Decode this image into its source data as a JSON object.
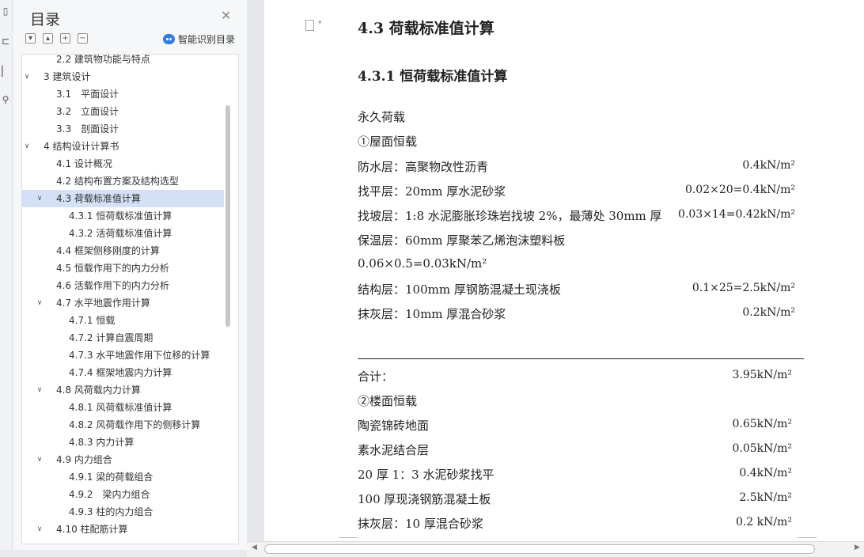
{
  "navigation": {
    "title": "目录",
    "smart_button_label": "智能识别目录",
    "toolbar": {
      "collapse": "−",
      "expand": "+"
    },
    "items": [
      {
        "label": "2.2 建筑物功能与特点",
        "level": 2,
        "expanded": null
      },
      {
        "label": "3 建筑设计",
        "level": 1,
        "expanded": true
      },
      {
        "label": "3.1　平面设计",
        "level": 2,
        "expanded": null
      },
      {
        "label": "3.2　立面设计",
        "level": 2,
        "expanded": null
      },
      {
        "label": "3.3　剖面设计",
        "level": 2,
        "expanded": null
      },
      {
        "label": "4 结构设计计算书",
        "level": 1,
        "expanded": true
      },
      {
        "label": "4.1 设计概况",
        "level": 2,
        "expanded": null
      },
      {
        "label": "4.2 结构布置方案及结构选型",
        "level": 2,
        "expanded": null
      },
      {
        "label": "4.3 荷载标准值计算",
        "level": 2,
        "expanded": true,
        "selected": true
      },
      {
        "label": "4.3.1 恒荷载标准值计算",
        "level": 3,
        "expanded": null
      },
      {
        "label": "4.3.2 活荷载标准值计算",
        "level": 3,
        "expanded": null
      },
      {
        "label": "4.4 框架侧移刚度的计算",
        "level": 2,
        "expanded": null
      },
      {
        "label": "4.5 恒载作用下的内力分析",
        "level": 2,
        "expanded": null
      },
      {
        "label": "4.6 活载作用下的内力分析",
        "level": 2,
        "expanded": null
      },
      {
        "label": "4.7 水平地震作用计算",
        "level": 2,
        "expanded": true
      },
      {
        "label": "4.7.1 恒载",
        "level": 3,
        "expanded": null
      },
      {
        "label": "4.7.2 计算自震周期",
        "level": 3,
        "expanded": null
      },
      {
        "label": "4.7.3 水平地震作用下位移的计算",
        "level": 3,
        "expanded": null
      },
      {
        "label": "4.7.4 框架地震内力计算",
        "level": 3,
        "expanded": null
      },
      {
        "label": "4.8 风荷载内力计算",
        "level": 2,
        "expanded": true
      },
      {
        "label": "4.8.1 风荷载标准值计算",
        "level": 3,
        "expanded": null
      },
      {
        "label": "4.8.2 风荷载作用下的侧移计算",
        "level": 3,
        "expanded": null
      },
      {
        "label": "4.8.3 内力计算",
        "level": 3,
        "expanded": null
      },
      {
        "label": "4.9 内力组合",
        "level": 2,
        "expanded": true
      },
      {
        "label": "4.9.1 梁的荷载组合",
        "level": 3,
        "expanded": null
      },
      {
        "label": "4.9.2　梁内力组合",
        "level": 3,
        "expanded": null
      },
      {
        "label": "4.9.3 柱的内力组合",
        "level": 3,
        "expanded": null
      },
      {
        "label": "4.10 柱配筋计算",
        "level": 2,
        "expanded": true
      }
    ]
  },
  "document": {
    "heading1": "4.3 荷载标准值计算",
    "heading2": "4.3.1 恒荷载标准值计算",
    "section_permanent": "永久荷载",
    "roof_title": "①屋面恒载",
    "roof_rows": [
      {
        "label": "防水层：高聚物改性沥青",
        "value": "0.4kN/m²"
      },
      {
        "label": "找平层：20mm 厚水泥砂浆",
        "value": "0.02×20=0.4kN/m²"
      },
      {
        "label": "找坡层：1:8 水泥膨胀珍珠岩找坡 2%，最薄处 30mm 厚",
        "value": "0.03×14=0.42kN/m²"
      },
      {
        "label": "保温层：60mm 厚聚苯乙烯泡沫塑料板",
        "value": ""
      },
      {
        "label": "0.06×0.5=0.03kN/m²",
        "value": ""
      },
      {
        "label": "结构层：100mm 厚钢筋混凝土现浇板",
        "value": "0.1×25=2.5kN/m²"
      },
      {
        "label": "抹灰层：10mm 厚混合砂浆",
        "value": "0.2kN/m²"
      }
    ],
    "total_label": "合计：",
    "total_value": "3.95kN/m²",
    "floor_title": "②楼面恒载",
    "floor_rows": [
      {
        "label": "陶瓷锦砖地面",
        "value": "0.65kN/m²"
      },
      {
        "label": "素水泥结合层",
        "value": "0.05kN/m²"
      },
      {
        "label": "20 厚 1：3 水泥砂浆找平",
        "value": "0.4kN/m²"
      },
      {
        "label": "100 厚现浇钢筋混凝土板",
        "value": "2.5kN/m²"
      },
      {
        "label": "抹灰层：10 厚混合砂浆",
        "value": "0.2 kN/m²"
      }
    ]
  }
}
